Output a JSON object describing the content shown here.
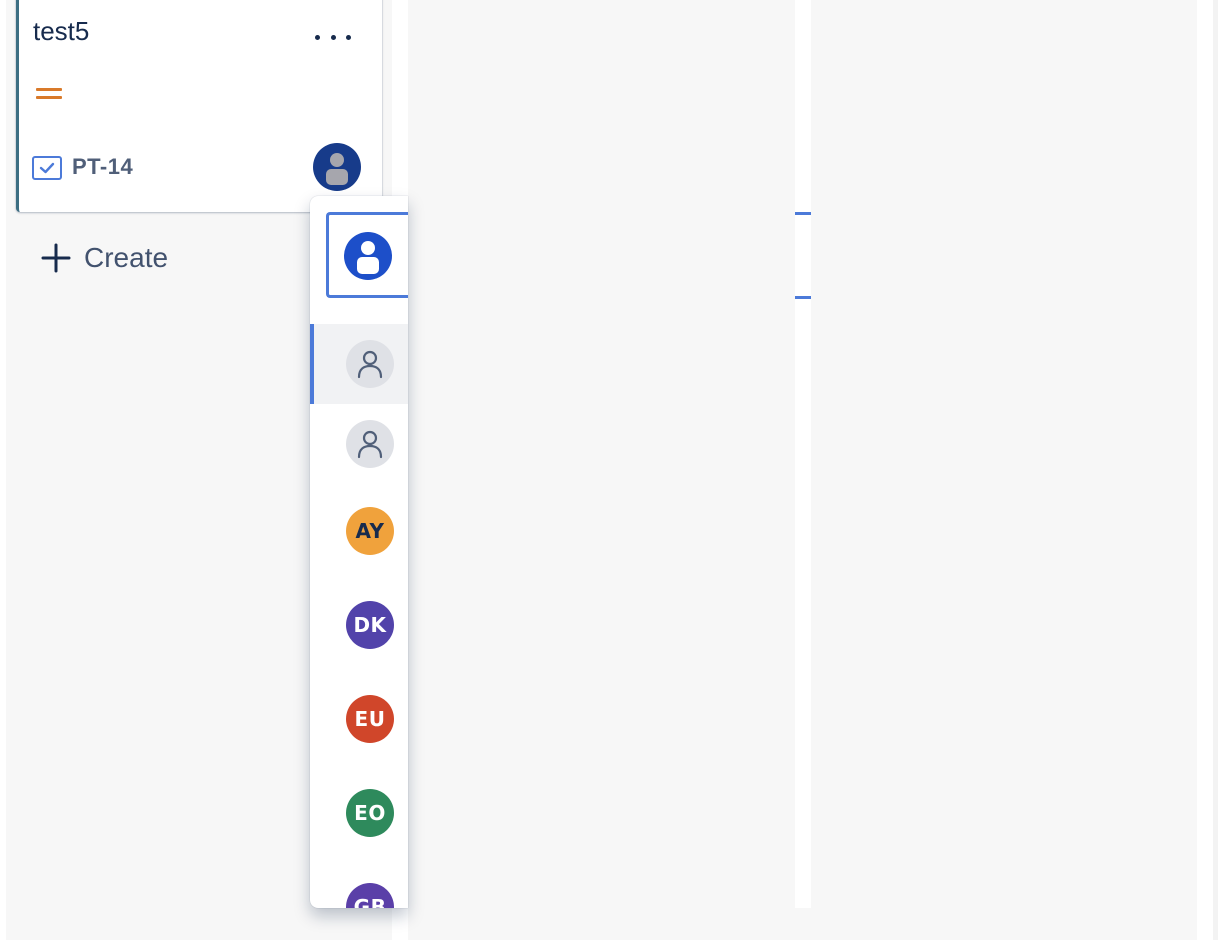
{
  "card": {
    "title": "test5",
    "key": "PT-14",
    "priority_color": "#d97a2a",
    "border_color": "#3c6e82",
    "menu_icon": "more-horizontal-icon",
    "type_icon": "task-checkbox-icon",
    "assignee_icon": "user-avatar-icon"
  },
  "board": {
    "create_label": "Create",
    "create_icon": "plus-icon"
  },
  "assignee_dropdown": {
    "input_avatar_color": "#1d4fc9",
    "options": [
      {
        "initials": "",
        "icon": "unassigned-user-icon",
        "color": "#dfe1e6",
        "selected": true
      },
      {
        "initials": "",
        "icon": "automatic-user-icon",
        "color": "#dfe1e6",
        "selected": false
      },
      {
        "initials": "AY",
        "color": "#f0a23c",
        "text_color": "#172b4d"
      },
      {
        "initials": "DK",
        "color": "#5243aa",
        "text_color": "#ffffff"
      },
      {
        "initials": "EU",
        "color": "#d0462a",
        "text_color": "#ffffff"
      },
      {
        "initials": "EO",
        "color": "#2e8a5c",
        "text_color": "#ffffff"
      },
      {
        "initials": "GB",
        "color": "#5a3fa8",
        "text_color": "#ffffff"
      }
    ]
  },
  "colors": {
    "column_bg": "#f7f7f7",
    "accent": "#4c7ad9"
  }
}
